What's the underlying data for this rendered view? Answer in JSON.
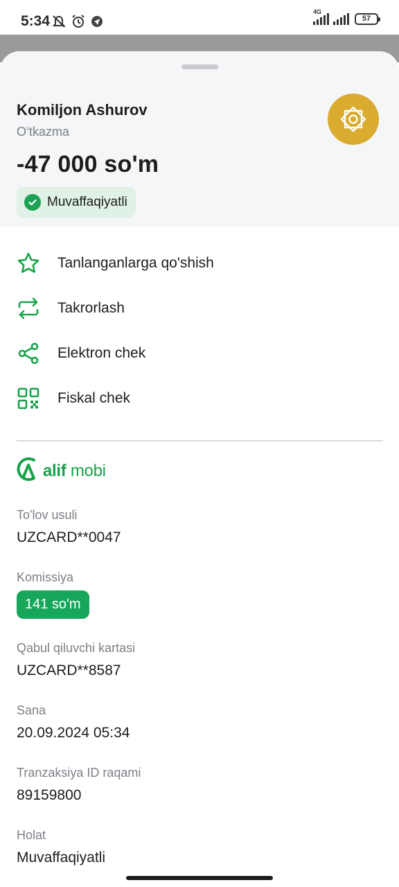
{
  "status_bar": {
    "time": "5:34",
    "network": "4G",
    "battery": "57",
    "icons": [
      "mute-icon",
      "alarm-icon",
      "app-notification-icon"
    ]
  },
  "header": {
    "payee": "Komiljon Ashurov",
    "kind": "O‘tkazma",
    "amount": "-47 000 so'm",
    "status": "Muvaffaqiyatli",
    "logo_icon": "ornament-logo-icon"
  },
  "actions": [
    {
      "label": "Tanlanganlarga qo'shish",
      "icon": "star-icon"
    },
    {
      "label": "Takrorlash",
      "icon": "repeat-icon"
    },
    {
      "label": "Elektron chek",
      "icon": "share-icon"
    },
    {
      "label": "Fiskal chek",
      "icon": "qr-code-icon"
    }
  ],
  "brand": {
    "bold": "alif",
    "rest": " mobi"
  },
  "details": {
    "payment_method": {
      "label": "To'lov usuli",
      "value": "UZCARD**0047"
    },
    "commission": {
      "label": "Komissiya",
      "value": "141 so'm"
    },
    "recipient_card": {
      "label": "Qabul qiluvchi kartasi",
      "value": "UZCARD**8587"
    },
    "date": {
      "label": "Sana",
      "value": "20.09.2024 05:34"
    },
    "transaction_id": {
      "label": "Tranzaksiya ID raqami",
      "value": "89159800"
    },
    "state": {
      "label": "Holat",
      "value": "Muvaffaqiyatli"
    }
  },
  "colors": {
    "accent": "#17a34a",
    "logo_gold": "#d9ab2f",
    "header_bg": "#f5f6f8"
  }
}
